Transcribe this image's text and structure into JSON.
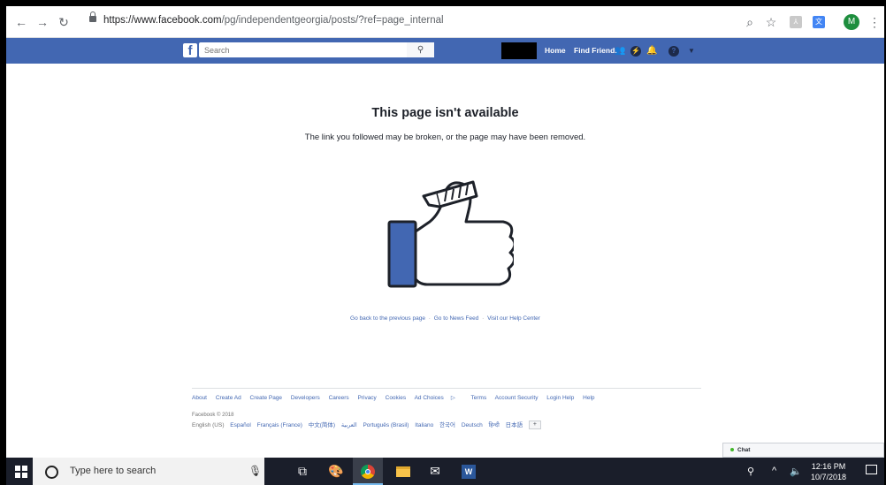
{
  "browser": {
    "url_host": "https://www.facebook.com",
    "url_path": "/pg/independentgeorgia/posts/?ref=page_internal",
    "icons": [
      "back-icon",
      "forward-icon",
      "reload-icon",
      "zoom-icon",
      "star-icon",
      "pdf-extension-icon",
      "translate-extension-icon",
      "profile-avatar",
      "menu-icon"
    ],
    "avatar_letter": "M"
  },
  "fb": {
    "logo": "f",
    "search_placeholder": "Search",
    "nav": {
      "home": "Home",
      "find_friends": "Find Friends"
    }
  },
  "content": {
    "title": "This page isn't available",
    "subtitle": "The link you followed may be broken, or the page may have been removed.",
    "links": [
      "Go back to the previous page",
      "Go to News Feed",
      "Visit our Help Center"
    ],
    "link_separator": " · "
  },
  "footer": {
    "links": [
      "About",
      "Create Ad",
      "Create Page",
      "Developers",
      "Careers",
      "Privacy",
      "Cookies",
      "Ad Choices",
      "Terms",
      "Account Security",
      "Login Help",
      "Help"
    ],
    "copyright": "Facebook © 2018",
    "current_language": "English (US)",
    "languages": [
      "Español",
      "Français (France)",
      "中文(简体)",
      "العربية",
      "Português (Brasil)",
      "Italiano",
      "한국어",
      "Deutsch",
      "हिन्दी",
      "日本語"
    ],
    "more_languages": "+"
  },
  "chat": {
    "label": "Chat",
    "status_color": "#42b72a"
  },
  "taskbar": {
    "search_placeholder": "Type here to search",
    "time": "12:16 PM",
    "date": "10/7/2018"
  },
  "colors": {
    "fb_blue": "#4267b2",
    "taskbar": "#1a1e2a"
  }
}
